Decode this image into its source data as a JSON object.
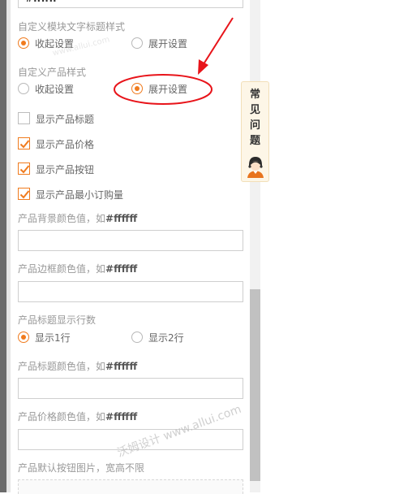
{
  "top_field_fragment": "#ffffff",
  "module_title_style": {
    "label": "自定义模块文字标题样式",
    "options": [
      "收起设置",
      "展开设置"
    ],
    "selected": 0
  },
  "product_style": {
    "label": "自定义产品样式",
    "options": [
      "收起设置",
      "展开设置"
    ],
    "selected": 1
  },
  "checkboxes": [
    {
      "label": "显示产品标题",
      "checked": false
    },
    {
      "label": "显示产品价格",
      "checked": true
    },
    {
      "label": "显示产品按钮",
      "checked": true
    },
    {
      "label": "显示产品最小订购量",
      "checked": true
    }
  ],
  "bg_color": {
    "label_prefix": "产品背景颜色值，如",
    "label_example": "#ffffff",
    "value": ""
  },
  "border_color": {
    "label_prefix": "产品边框颜色值，如",
    "label_example": "#ffffff",
    "value": ""
  },
  "title_lines": {
    "label": "产品标题显示行数",
    "options": [
      "显示1行",
      "显示2行"
    ],
    "selected": 0
  },
  "title_color": {
    "label_prefix": "产品标题颜色值，如",
    "label_example": "#ffffff",
    "value": ""
  },
  "price_color": {
    "label_prefix": "产品价格颜色值，如",
    "label_example": "#ffffff",
    "value": ""
  },
  "button_image": {
    "label": "产品默认按钮图片，宽高不限"
  },
  "faq": {
    "text": "常见问题",
    "icon": "customer-service-avatar-icon"
  },
  "watermarks": [
    "沃姆设计 www.allui.com",
    "www.allui.com"
  ],
  "colors": {
    "accent": "#f07b1e",
    "annotation": "#e8141a"
  }
}
